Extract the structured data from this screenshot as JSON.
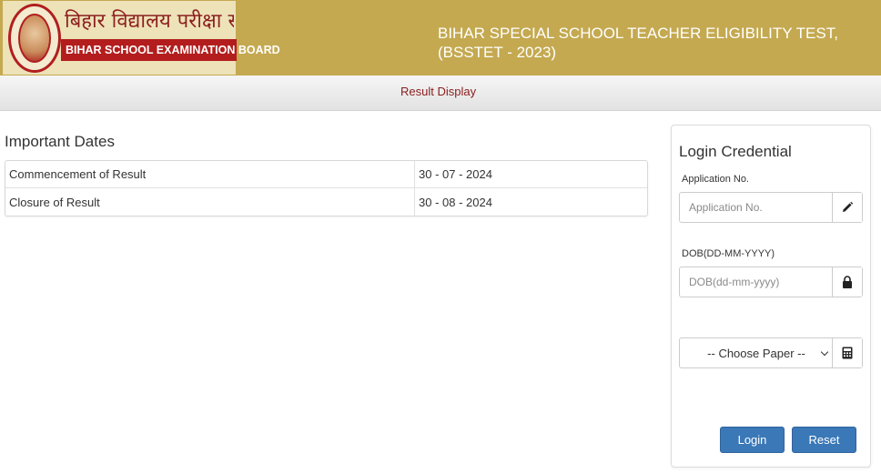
{
  "header": {
    "logo_hindi": "बिहार विद्यालय परीक्षा समिति",
    "logo_english": "BIHAR SCHOOL EXAMINATION BOARD",
    "title_line1": "BIHAR SPECIAL SCHOOL TEACHER ELIGIBILITY TEST,",
    "title_line2": "(BSSTET - 2023)"
  },
  "nav": {
    "result_display": "Result Display"
  },
  "important_dates": {
    "title": "Important Dates",
    "rows": [
      {
        "label": "Commencement of Result",
        "value": "30 - 07 - 2024"
      },
      {
        "label": "Closure of Result",
        "value": "30 - 08 - 2024"
      }
    ]
  },
  "login": {
    "title": "Login Credential",
    "application_label": "Application No.",
    "application_placeholder": "Application No.",
    "application_value": "",
    "dob_label": "DOB(DD-MM-YYYY)",
    "dob_placeholder": "DOB(dd-mm-yyyy)",
    "dob_value": "",
    "paper_selected": "-- Choose Paper --",
    "login_button": "Login",
    "reset_button": "Reset",
    "icons": {
      "application": "pencil-icon",
      "dob": "lock-icon",
      "paper": "calculator-icon"
    }
  },
  "colors": {
    "header_bg": "#c4a950",
    "brand_red": "#b31d1d",
    "nav_link": "#8a1c1c",
    "button_blue": "#3a78b8"
  }
}
